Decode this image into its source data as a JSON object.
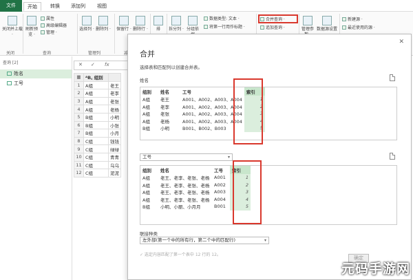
{
  "tabs": [
    "文件",
    "开始",
    "转换",
    "添加列",
    "视图"
  ],
  "ribbon": {
    "close_load": "关闭并上载 ·",
    "refresh": "刷新预览 ·",
    "properties": "属性",
    "advanced_editor": "高级编辑器",
    "manage": "管理 ·",
    "choose_cols": "选择列 ·",
    "remove_cols": "删除列 ·",
    "keep_rows": "保留行 ·",
    "remove_rows": "删除行 ·",
    "sort": "排",
    "split": "拆分列 ·",
    "group": "分组依据",
    "data_type": "数据类型: 文本 ·",
    "first_row_header": "将第一行用作标题 ·",
    "merge_queries": "合并查询 ·",
    "append_queries": "追加查询 ·",
    "manage_params": "管理参数 ·",
    "data_source_settings": "数据源设置",
    "new_source": "新建源 ·",
    "recent_sources": "最近使用的源 ·",
    "group_close": "关闭",
    "group_query": "查询",
    "group_manage_cols": "管理列",
    "group_reduce_rows": "减少行"
  },
  "queries": {
    "header": "查询 [2]",
    "items": [
      "姓名",
      "工号"
    ]
  },
  "grid": {
    "formula": "fx",
    "col_header": "组别",
    "rows": [
      {
        "n": "1",
        "a": "A组",
        "b": "老王"
      },
      {
        "n": "2",
        "a": "A组",
        "b": "老李"
      },
      {
        "n": "3",
        "a": "A组",
        "b": "老张"
      },
      {
        "n": "4",
        "a": "A组",
        "b": "老杨"
      },
      {
        "n": "5",
        "a": "B组",
        "b": "小明"
      },
      {
        "n": "6",
        "a": "B组",
        "b": "小张"
      },
      {
        "n": "7",
        "a": "B组",
        "b": "小月"
      },
      {
        "n": "8",
        "a": "C组",
        "b": "钱钱"
      },
      {
        "n": "9",
        "a": "C组",
        "b": "绿绿"
      },
      {
        "n": "10",
        "a": "C组",
        "b": "青青"
      },
      {
        "n": "11",
        "a": "C组",
        "b": "乌乌"
      },
      {
        "n": "12",
        "a": "C组",
        "b": "泥泥"
      }
    ]
  },
  "dialog": {
    "title": "合并",
    "close": "✕",
    "description": "选择表和匹配列以创建合并表。",
    "table1_name": "姓名",
    "table1_headers": [
      "组别",
      "姓名",
      "工号",
      "索引"
    ],
    "table1_rows": [
      [
        "A组",
        "老王",
        "A001、A002、A003、A004",
        "1"
      ],
      [
        "A组",
        "老李",
        "A001、A002、A003、A004",
        "2"
      ],
      [
        "A组",
        "老张",
        "A001、A002、A003、A004",
        "3"
      ],
      [
        "A组",
        "老杨",
        "A001、A002、A003、A004",
        "4"
      ],
      [
        "B组",
        "小明",
        "B001、B002、B003",
        "5"
      ]
    ],
    "table2_select": "工号",
    "table2_headers": [
      "组别",
      "姓名",
      "工号",
      "索引"
    ],
    "table2_rows": [
      [
        "A组",
        "老王、老李、老张、老杨",
        "A001",
        "1"
      ],
      [
        "A组",
        "老王、老李、老张、老杨",
        "A002",
        "2"
      ],
      [
        "A组",
        "老王、老李、老张、老杨",
        "A003",
        "3"
      ],
      [
        "A组",
        "老王、老李、老张、老杨",
        "A004",
        "4"
      ],
      [
        "B组",
        "小明、小丽、小月月",
        "B001",
        "5"
      ]
    ],
    "join_label": "联接种类",
    "join_value": "左外部(第一个中的所有行，第二个中的匹配行)",
    "match_status": "✓ 选定内容匹配了第一个表中 12 行的 12。",
    "ok": "确定"
  },
  "watermark": "元码手游网"
}
